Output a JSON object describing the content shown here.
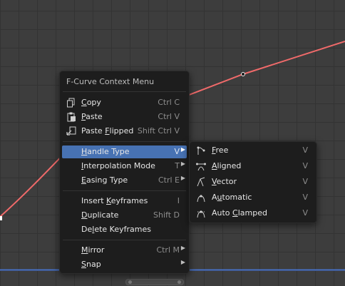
{
  "menu": {
    "title": "F-Curve Context Menu",
    "items": [
      {
        "label": "Copy",
        "u": "C",
        "shortcut": "Ctrl C",
        "icon": "copy-icon"
      },
      {
        "label": "Paste",
        "u": "P",
        "shortcut": "Ctrl V",
        "icon": "paste-icon"
      },
      {
        "label": "Paste Flipped",
        "u": "F",
        "shortcut": "Shift Ctrl V",
        "icon": "paste-flipped-icon"
      },
      {
        "label": "Handle Type",
        "u": "H",
        "shortcut": "V",
        "submenu": true,
        "highlighted": true
      },
      {
        "label": "Interpolation Mode",
        "u": "I",
        "shortcut": "T",
        "submenu": true
      },
      {
        "label": "Easing Type",
        "u": "E",
        "shortcut": "Ctrl E",
        "submenu": true
      },
      {
        "label": "Insert Keyframes",
        "u": "K",
        "shortcut": "I"
      },
      {
        "label": "Duplicate",
        "u": "D",
        "shortcut": "Shift D"
      },
      {
        "label": "Delete Keyframes",
        "u": "l",
        "shortcut": ""
      },
      {
        "label": "Mirror",
        "u": "M",
        "shortcut": "Ctrl M",
        "submenu": true
      },
      {
        "label": "Snap",
        "u": "S",
        "shortcut": "",
        "submenu": true
      }
    ]
  },
  "submenu": {
    "items": [
      {
        "label": "Free",
        "u": "F",
        "shortcut": "V",
        "icon": "handle-free-icon"
      },
      {
        "label": "Aligned",
        "u": "A",
        "shortcut": "V",
        "icon": "handle-aligned-icon"
      },
      {
        "label": "Vector",
        "u": "V",
        "shortcut": "V",
        "icon": "handle-vector-icon"
      },
      {
        "label": "Automatic",
        "u": "u",
        "shortcut": "V",
        "icon": "handle-auto-icon"
      },
      {
        "label": "Auto Clamped",
        "u": "C",
        "shortcut": "V",
        "icon": "handle-auto-clamped-icon"
      }
    ]
  },
  "colors": {
    "background": "#3d3d3d",
    "grid": "#333333",
    "curve": "#f06a6a",
    "baseline": "#4872c8",
    "menu_bg": "#1d1d1d",
    "highlight": "#4772b3"
  }
}
